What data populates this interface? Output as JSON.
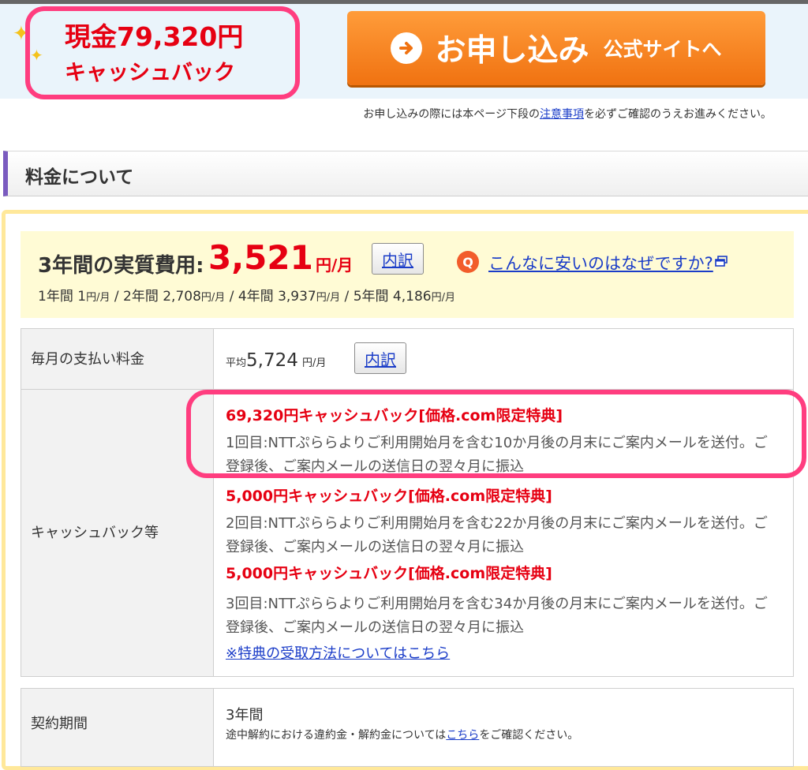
{
  "banner": {
    "cashback_line1": "現金79,320円",
    "cashback_line2": "キャッシュバック",
    "apply_main": "お申し込み",
    "apply_sub": "公式サイトへ",
    "notice_before": "お申し込みの際には本ページ下段の",
    "notice_link": "注意事項",
    "notice_after": "を必ずご確認のうえお進みください。"
  },
  "section": {
    "title": "料金について"
  },
  "cost": {
    "label": "3年間の実質費用:",
    "value": "3,521",
    "unit": "円/月",
    "breakdown_button": "内訳",
    "q_icon_label": "Q",
    "why_link": "こんなに安いのはなぜですか?",
    "periods": [
      {
        "label": "1年間",
        "value": "1",
        "unit": "円/月"
      },
      {
        "label": "2年間",
        "value": "2,708",
        "unit": "円/月"
      },
      {
        "label": "4年間",
        "value": "3,937",
        "unit": "円/月"
      },
      {
        "label": "5年間",
        "value": "4,186",
        "unit": "円/月"
      }
    ]
  },
  "monthly": {
    "header": "毎月の支払い料金",
    "prefix": "平均",
    "value": "5,724",
    "unit": "円/月",
    "breakdown_button": "内訳"
  },
  "cashback": {
    "header": "キャッシュバック等",
    "items": [
      {
        "title": "69,320円キャッシュバック[価格.com限定特典]",
        "desc": "1回目:NTTぷららよりご利用開始月を含む10か月後の月末にご案内メールを送付。ご登録後、ご案内メールの送信日の翌々月に振込"
      },
      {
        "title": "5,000円キャッシュバック[価格.com限定特典]",
        "desc": "2回目:NTTぷららよりご利用開始月を含む22か月後の月末にご案内メールを送付。ご登録後、ご案内メールの送信日の翌々月に振込"
      },
      {
        "title": "5,000円キャッシュバック[価格.com限定特典]",
        "desc": "3回目:NTTぷららよりご利用開始月を含む34か月後の月末にご案内メールを送付。ご登録後、ご案内メールの送信日の翌々月に振込"
      }
    ],
    "how_to_link": "※特典の受取方法についてはこちら"
  },
  "contract": {
    "header": "契約期間",
    "value": "3年間",
    "note_before": "途中解約における違約金・解約金については",
    "note_link": "こちら",
    "note_after": "をご確認ください。"
  },
  "colors": {
    "accent_red": "#e60012",
    "highlight_pink": "#ff3d7f",
    "button_orange": "#f07211",
    "link_blue": "#1a3cc8",
    "frame_yellow": "#ffe89a"
  },
  "icons": [
    "sparkle-icon",
    "arrow-right-circle-icon",
    "question-icon",
    "external-window-icon"
  ]
}
